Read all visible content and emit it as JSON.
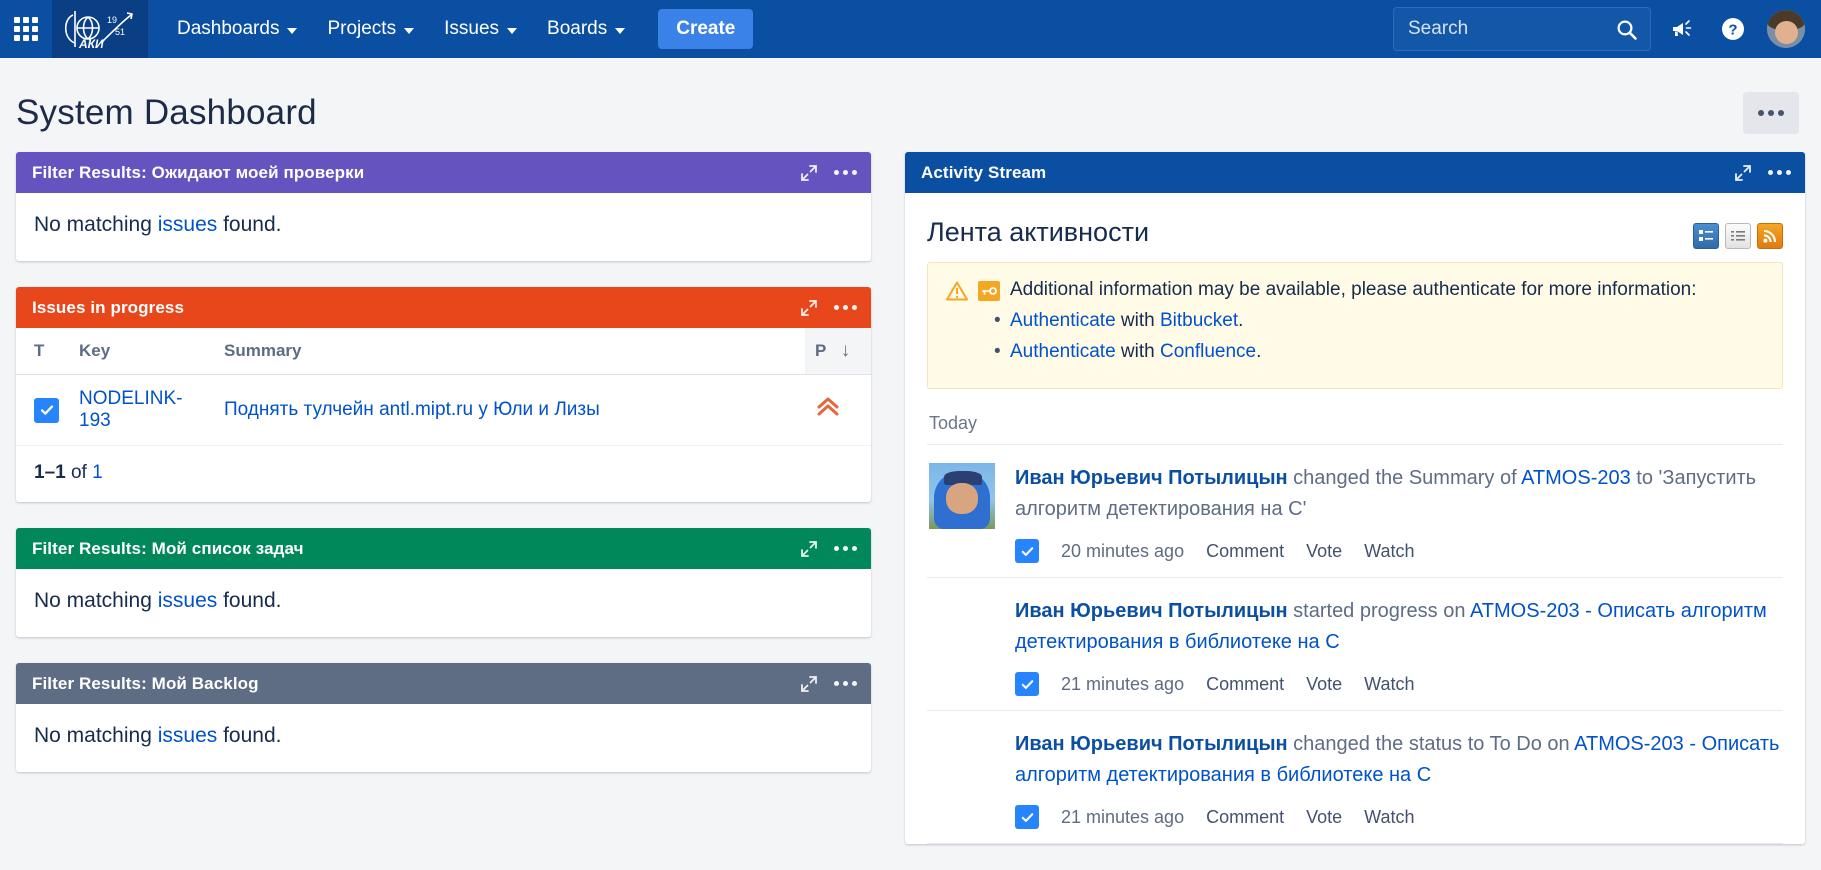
{
  "nav": {
    "app_switcher": "app-switcher",
    "logo_alt": "ФАКИ 1951",
    "items": [
      {
        "label": "Dashboards",
        "has_caret": true
      },
      {
        "label": "Projects",
        "has_caret": true
      },
      {
        "label": "Issues",
        "has_caret": true
      },
      {
        "label": "Boards",
        "has_caret": true
      }
    ],
    "create_label": "Create",
    "search_placeholder": "Search",
    "search_value": ""
  },
  "page": {
    "title": "System Dashboard",
    "more_label": "•••"
  },
  "left_gadgets": [
    {
      "title": "Filter Results: Ожидают моей проверки",
      "color": "#6554c0",
      "empty_pre": "No matching ",
      "empty_link": "issues",
      "empty_post": " found."
    },
    {
      "title": "Issues in progress",
      "color": "#e8471c",
      "columns": [
        "T",
        "Key",
        "Summary",
        "P"
      ],
      "sort_col": "P",
      "sort_dir": "↓",
      "rows": [
        {
          "type_icon": "task-icon",
          "key": "NODELINK-193",
          "summary": "Поднять тулчейн antl.mipt.ru у Юли и Лизы",
          "priority_icon": "priority-highest-icon"
        }
      ],
      "paging_range": "1–1",
      "paging_of": " of ",
      "paging_total": "1"
    },
    {
      "title": "Filter Results: Мой список задач",
      "color": "#00875a",
      "empty_pre": "No matching ",
      "empty_link": "issues",
      "empty_post": " found."
    },
    {
      "title": "Filter Results: Мой Backlog",
      "color": "#5e6c84",
      "empty_pre": "No matching ",
      "empty_link": "issues",
      "empty_post": " found."
    }
  ],
  "activity": {
    "gadget_title": "Activity Stream",
    "gadget_color": "#0b4fa3",
    "heading": "Лента активности",
    "view_icons": [
      "summary-view-icon",
      "list-view-icon",
      "rss-feed-icon"
    ],
    "warning": {
      "text": "Additional information may be available, please authenticate for more information:",
      "links": [
        {
          "pre": "Authenticate",
          "mid": " with ",
          "target": "Bitbucket",
          "post": "."
        },
        {
          "pre": "Authenticate",
          "mid": " with ",
          "target": "Confluence",
          "post": "."
        }
      ]
    },
    "day_separator": "Today",
    "entries": [
      {
        "user": "Иван Юрьевич Потылицын",
        "action": " changed the Summary of ",
        "issue_key": "ATMOS-203",
        "tail": " to 'Запустить алгоритм детектирования на C'",
        "time": "20 minutes ago",
        "actions": [
          "Comment",
          "Vote",
          "Watch"
        ],
        "has_avatar": true
      },
      {
        "user": "Иван Юрьевич Потылицын",
        "action": " started progress on ",
        "issue_key": "ATMOS-203",
        "tail_link": " - Описать алгоритм детектирования в библиотеке на C",
        "time": "21 minutes ago",
        "actions": [
          "Comment",
          "Vote",
          "Watch"
        ],
        "has_avatar": false
      },
      {
        "user": "Иван Юрьевич Потылицын",
        "action": " changed the status to To Do on ",
        "issue_key": "ATMOS-203",
        "tail_link": " - Описать алгоритм детектирования в библиотеке на C",
        "time": "21 minutes ago",
        "actions": [
          "Comment",
          "Vote",
          "Watch"
        ],
        "has_avatar": false
      }
    ]
  },
  "colors": {
    "nav_bg": "#0b4fa3",
    "create_btn": "#3b82e8",
    "link": "#0052cc",
    "page_bg": "#f4f5f7"
  }
}
